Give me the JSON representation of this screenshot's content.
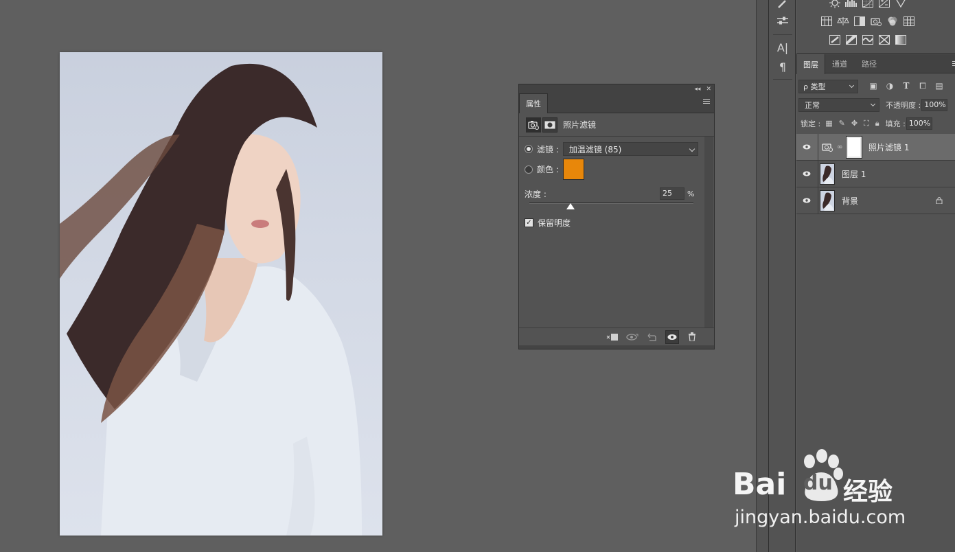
{
  "canvas": {
    "image_alt": "portrait-photo"
  },
  "properties_panel": {
    "tab_label": "属性",
    "adjustment_title": "照片滤镜",
    "filter_label": "滤镜 :",
    "filter_value": "加温滤镜 (85)",
    "color_label": "颜色 :",
    "color_swatch": "#e8870a",
    "density_label": "浓度 :",
    "density_value": "25",
    "density_unit": "%",
    "density_fraction": 0.25,
    "preserve_luminosity_label": "保留明度",
    "preserve_luminosity_checked": true,
    "top_controls": [
      "◂◂",
      "✕"
    ]
  },
  "layers_panel": {
    "tabs": [
      {
        "label": "图层",
        "active": true
      },
      {
        "label": "通道",
        "active": false
      },
      {
        "label": "路径",
        "active": false
      }
    ],
    "kind_filter": "ρ 类型",
    "blend_mode": "正常",
    "opacity_label": "不透明度 :",
    "opacity_value": "100%",
    "lock_label": "锁定 :",
    "fill_label": "填充 :",
    "fill_value": "100%",
    "layers": [
      {
        "name": "照片滤镜 1",
        "type": "adjustment",
        "selected": true,
        "visible": true
      },
      {
        "name": "图层 1",
        "type": "pixel",
        "selected": false,
        "visible": true
      },
      {
        "name": "背景",
        "type": "background",
        "selected": false,
        "visible": true,
        "locked": true
      }
    ]
  },
  "toolstrip": {
    "icons": [
      "brush-settings-icon",
      "adjustments-icon",
      "character-icon",
      "paragraph-icon"
    ]
  },
  "watermark": {
    "brand": "Bai",
    "brand_du": "du",
    "brand_cn": "经验",
    "url": "jingyan.baidu.com"
  },
  "colors": {
    "accent_swatch": "#e8870a",
    "panel_bg": "#535353",
    "workspace_bg": "#5f5f5f"
  }
}
